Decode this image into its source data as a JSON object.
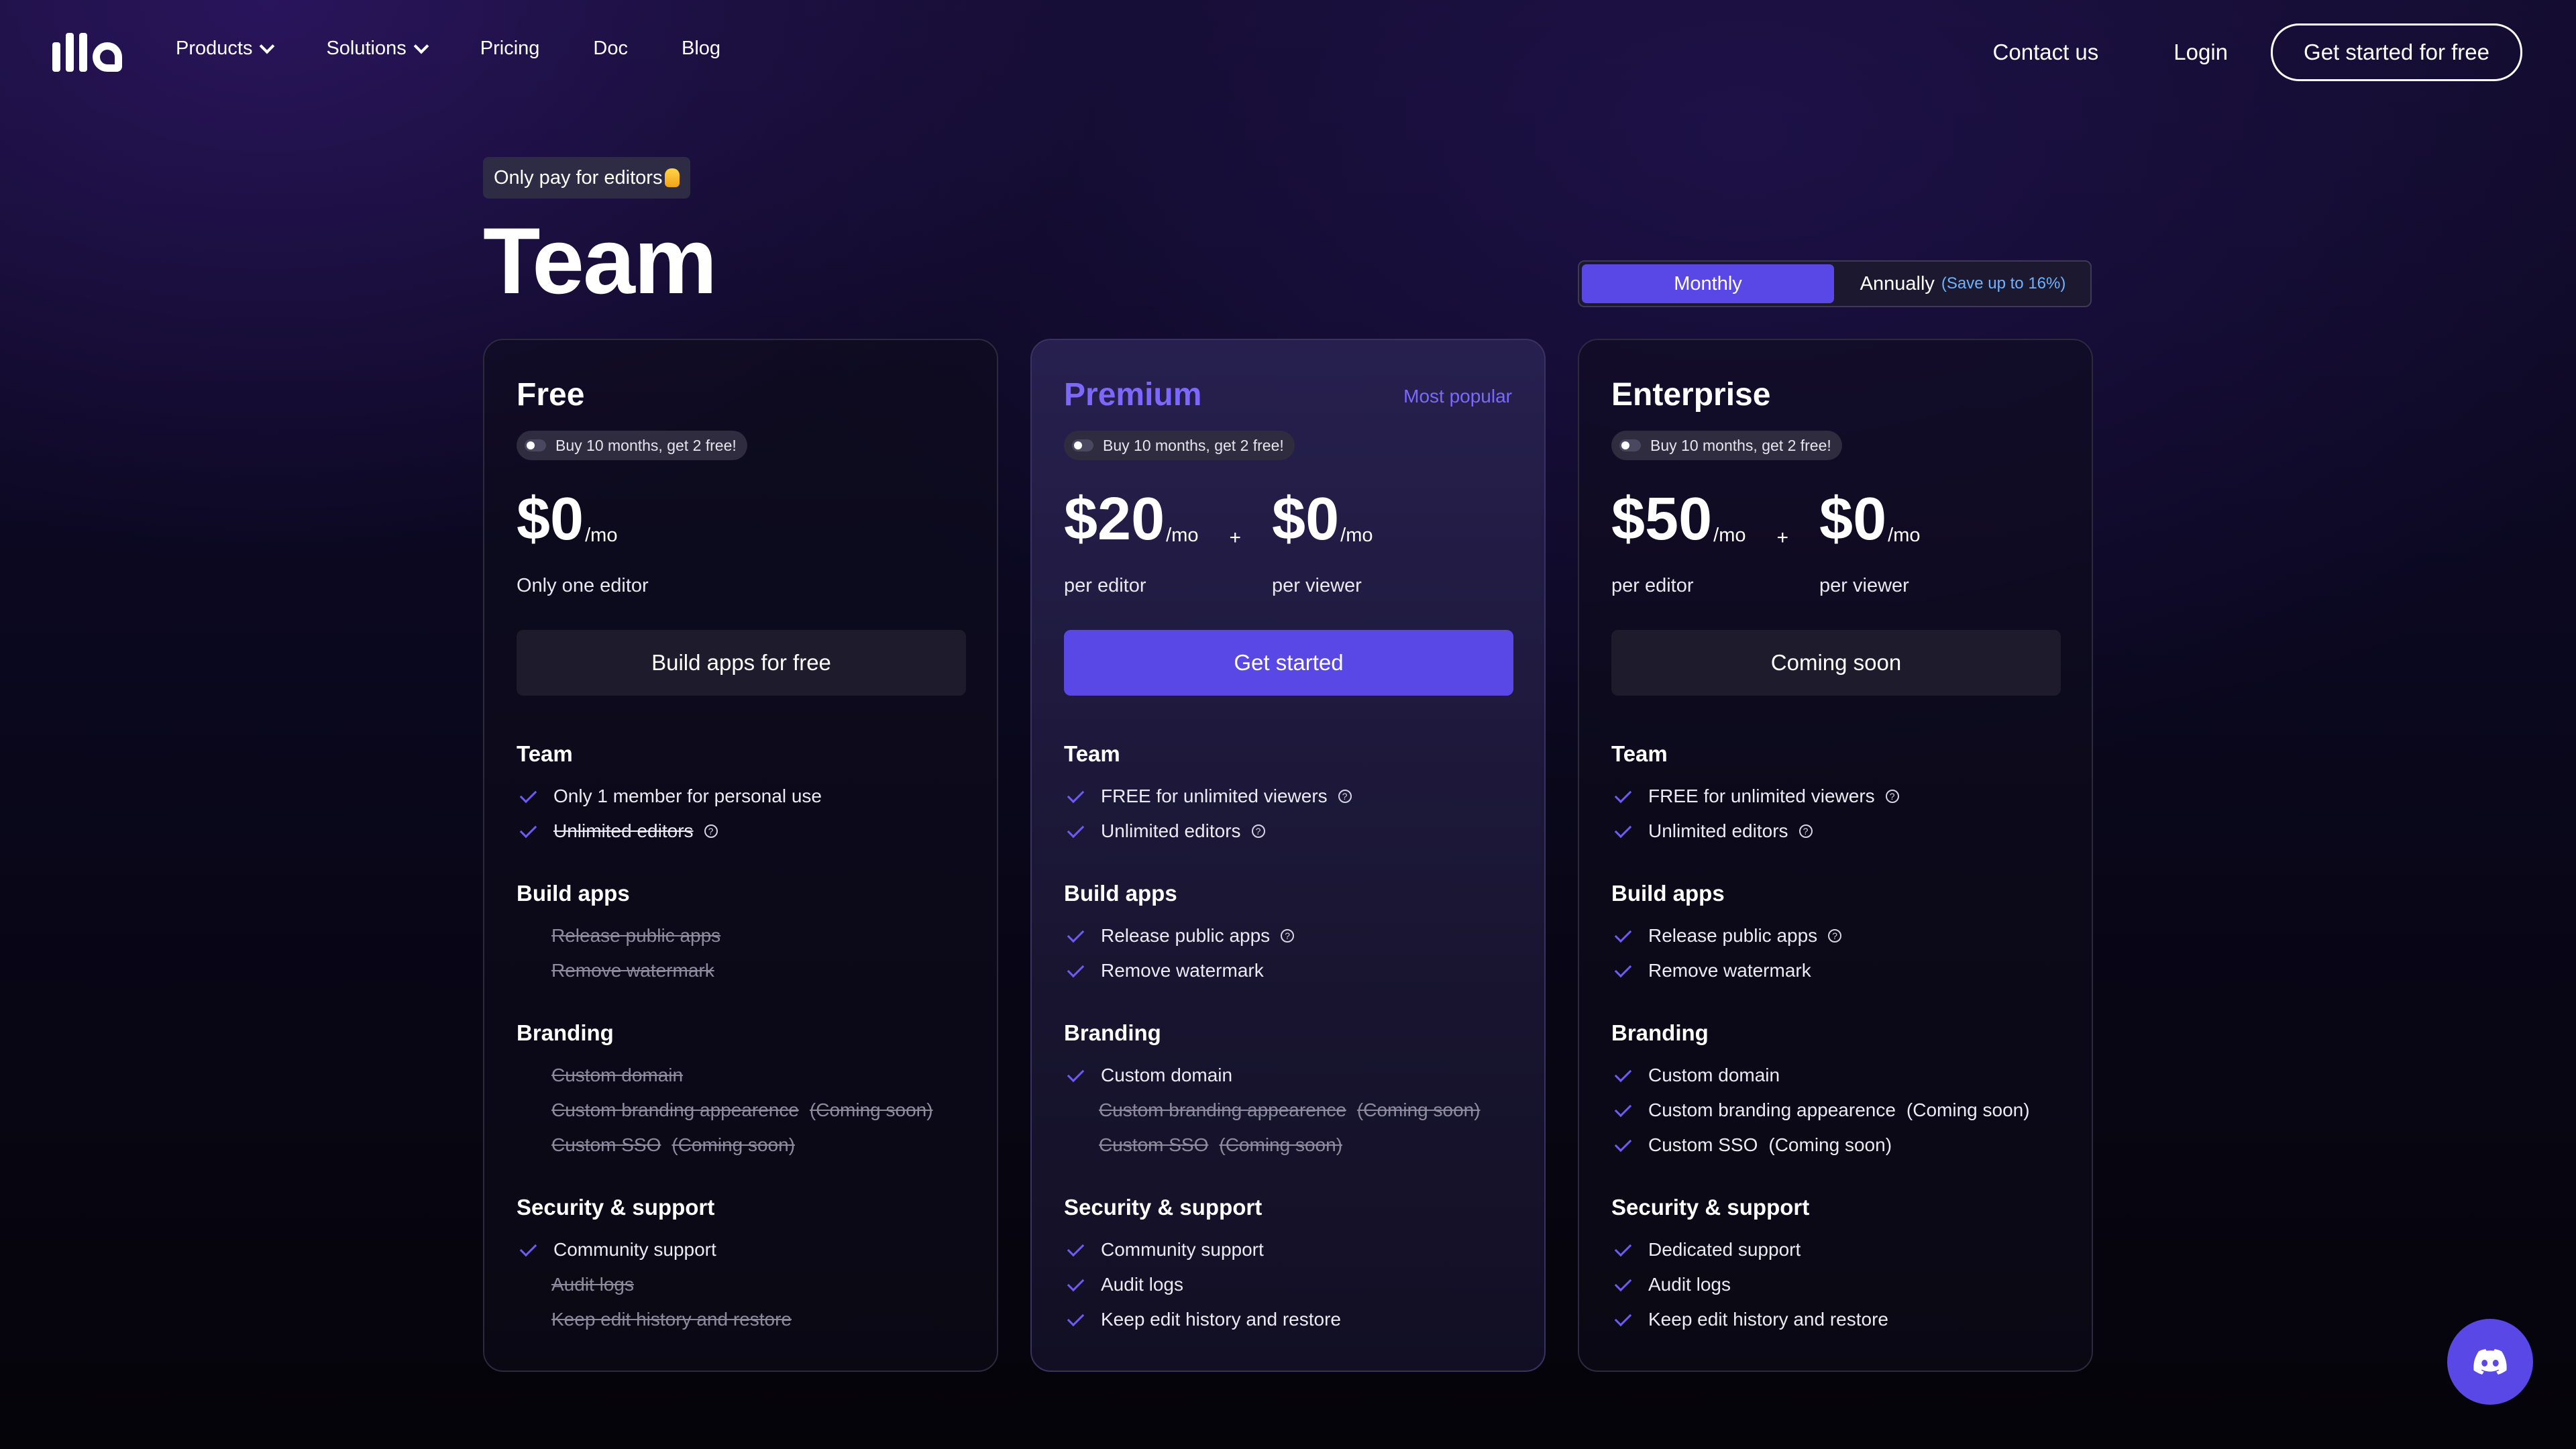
{
  "nav": {
    "logo_alt": "illa",
    "links": [
      {
        "label": "Products",
        "has_dropdown": true
      },
      {
        "label": "Solutions",
        "has_dropdown": true
      },
      {
        "label": "Pricing",
        "has_dropdown": false
      },
      {
        "label": "Doc",
        "has_dropdown": false
      },
      {
        "label": "Blog",
        "has_dropdown": false
      }
    ],
    "contact": "Contact us",
    "login": "Login",
    "cta": "Get started for free"
  },
  "header": {
    "pill": "Only pay for editors",
    "title": "Team"
  },
  "billing_toggle": {
    "monthly": "Monthly",
    "annually": "Annually",
    "annual_note": "(Save up to 16%)",
    "selected": "Monthly"
  },
  "plans": [
    {
      "name": "Free",
      "tag": "",
      "discount_badge": "Buy 10 months, get 2 free!",
      "prices": [
        {
          "amount": "$0",
          "unit": "/mo",
          "subtitle": "Only one editor"
        }
      ],
      "cta": "Build apps for free",
      "sections": [
        {
          "title": "Team",
          "items": [
            {
              "text": "Only 1 member for personal use",
              "included": true,
              "help": false,
              "note": ""
            },
            {
              "text": "Unlimited editors",
              "included": false,
              "checked": true,
              "help": true,
              "note": ""
            }
          ]
        },
        {
          "title": "Build apps",
          "items": [
            {
              "text": "Release public apps",
              "included": false,
              "help": false,
              "note": ""
            },
            {
              "text": "Remove watermark",
              "included": false,
              "help": false,
              "note": ""
            }
          ]
        },
        {
          "title": "Branding",
          "items": [
            {
              "text": "Custom domain",
              "included": false,
              "help": false,
              "note": ""
            },
            {
              "text": "Custom branding appearence",
              "included": false,
              "help": false,
              "note": "(Coming soon)"
            },
            {
              "text": "Custom SSO",
              "included": false,
              "help": false,
              "note": "(Coming soon)"
            }
          ]
        },
        {
          "title": "Security & support",
          "items": [
            {
              "text": "Community support",
              "included": true,
              "help": false,
              "note": ""
            },
            {
              "text": "Audit logs",
              "included": false,
              "help": false,
              "note": ""
            },
            {
              "text": "Keep edit history and restore",
              "included": false,
              "help": false,
              "note": ""
            }
          ]
        }
      ]
    },
    {
      "name": "Premium",
      "tag": "Most popular",
      "discount_badge": "Buy 10 months, get 2 free!",
      "prices": [
        {
          "amount": "$20",
          "unit": "/mo",
          "subtitle": "per editor"
        },
        {
          "amount": "$0",
          "unit": "/mo",
          "subtitle": "per viewer"
        }
      ],
      "plus": "+",
      "cta": "Get started",
      "sections": [
        {
          "title": "Team",
          "items": [
            {
              "text": "FREE for unlimited viewers",
              "included": true,
              "help": true,
              "note": ""
            },
            {
              "text": "Unlimited editors",
              "included": true,
              "help": true,
              "note": ""
            }
          ]
        },
        {
          "title": "Build apps",
          "items": [
            {
              "text": "Release public apps",
              "included": true,
              "help": true,
              "note": ""
            },
            {
              "text": "Remove watermark",
              "included": true,
              "help": false,
              "note": ""
            }
          ]
        },
        {
          "title": "Branding",
          "items": [
            {
              "text": "Custom domain",
              "included": true,
              "help": false,
              "note": ""
            },
            {
              "text": "Custom branding appearence",
              "included": false,
              "help": false,
              "note": "(Coming soon)"
            },
            {
              "text": "Custom SSO",
              "included": false,
              "help": false,
              "note": "(Coming soon)"
            }
          ]
        },
        {
          "title": "Security & support",
          "items": [
            {
              "text": "Community support",
              "included": true,
              "help": false,
              "note": ""
            },
            {
              "text": "Audit logs",
              "included": true,
              "help": false,
              "note": ""
            },
            {
              "text": "Keep edit history and restore",
              "included": true,
              "help": false,
              "note": ""
            }
          ]
        }
      ]
    },
    {
      "name": "Enterprise",
      "tag": "",
      "discount_badge": "Buy 10 months, get 2 free!",
      "prices": [
        {
          "amount": "$50",
          "unit": "/mo",
          "subtitle": "per editor"
        },
        {
          "amount": "$0",
          "unit": "/mo",
          "subtitle": "per viewer"
        }
      ],
      "plus": "+",
      "cta": "Coming soon",
      "sections": [
        {
          "title": "Team",
          "items": [
            {
              "text": "FREE for unlimited viewers",
              "included": true,
              "help": true,
              "note": ""
            },
            {
              "text": "Unlimited editors",
              "included": true,
              "help": true,
              "note": ""
            }
          ]
        },
        {
          "title": "Build apps",
          "items": [
            {
              "text": "Release public apps",
              "included": true,
              "help": true,
              "note": ""
            },
            {
              "text": "Remove watermark",
              "included": true,
              "help": false,
              "note": ""
            }
          ]
        },
        {
          "title": "Branding",
          "items": [
            {
              "text": "Custom domain",
              "included": true,
              "help": false,
              "note": ""
            },
            {
              "text": "Custom branding appearence",
              "included": true,
              "help": false,
              "note": "(Coming soon)"
            },
            {
              "text": "Custom SSO",
              "included": true,
              "help": false,
              "note": "(Coming soon)"
            }
          ]
        },
        {
          "title": "Security & support",
          "items": [
            {
              "text": "Dedicated support",
              "included": true,
              "help": false,
              "note": ""
            },
            {
              "text": "Audit logs",
              "included": true,
              "help": false,
              "note": ""
            },
            {
              "text": "Keep edit history and restore",
              "included": true,
              "help": false,
              "note": ""
            }
          ]
        }
      ]
    }
  ],
  "colors": {
    "accent": "#5a48e6",
    "check": "#6e5bf5",
    "annual_note": "#6fb3ff"
  },
  "icons": {
    "discord": "discord-icon",
    "help": "question-circle-icon",
    "check": "check-icon",
    "chevron": "chevron-down-icon",
    "emoji": "victory-hand-icon"
  }
}
